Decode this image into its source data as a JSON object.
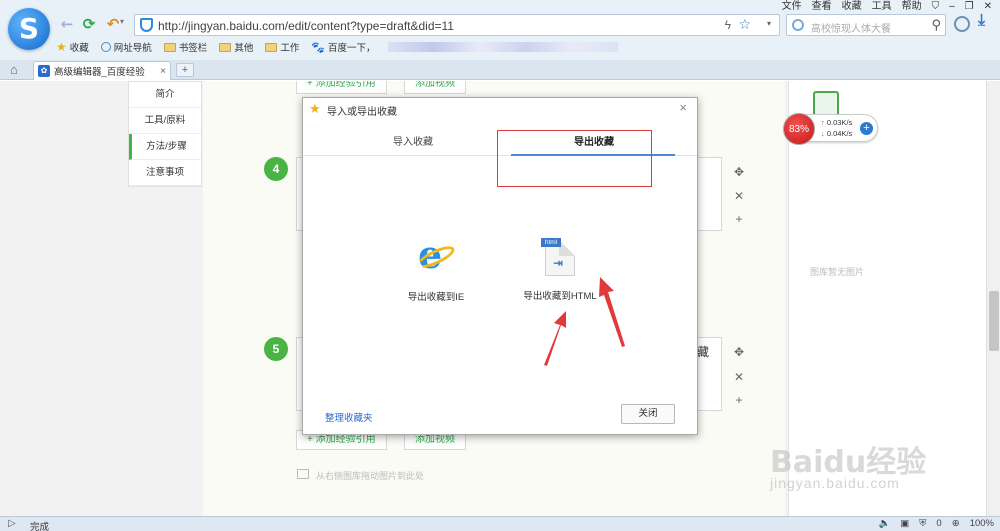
{
  "browser": {
    "url": "http://jingyan.baidu.com/edit/content?type=draft&did=11",
    "search_placeholder": "高校惊现人体大餐",
    "menu": [
      "文件",
      "查看",
      "收藏",
      "工具",
      "帮助"
    ],
    "bookmarks": [
      "收藏",
      "网址导航",
      "书签栏",
      "其他",
      "工作",
      "百度一下，"
    ],
    "tab_title": "高级编辑器_百度经验",
    "tab_close": "×",
    "new_tab": "+"
  },
  "sidenav": {
    "items": [
      "简介",
      "工具/原料",
      "方法/步骤",
      "注意事项"
    ]
  },
  "editor": {
    "step4": "4",
    "step5": "5",
    "btn_add_ref": "+ 添加经验引用",
    "btn_add_video": "添加视频",
    "hint": "从右侧图库拖动图片到此处",
    "partial_text": "藏"
  },
  "gallery": {
    "empty": "图库暂无图片"
  },
  "net_widget": {
    "percent": "83%",
    "up": "0.03K/s",
    "down": "0.04K/s"
  },
  "dialog": {
    "title": "导入或导出收藏",
    "close": "×",
    "tab_import": "导入收藏",
    "tab_export": "导出收藏",
    "option_ie": "导出收藏到IE",
    "option_html": "导出收藏到HTML",
    "html_tag": "html",
    "organize_link": "整理收藏夹",
    "close_button": "关闭"
  },
  "watermark": {
    "brand": "Baidu经验",
    "url": "jingyan.baidu.com"
  },
  "status": {
    "text": "完成",
    "count": "0",
    "zoom": "100%"
  },
  "colors": {
    "accent_green": "#49b444",
    "annotation_red": "#e03a3a",
    "link_blue": "#2b6bd0"
  }
}
